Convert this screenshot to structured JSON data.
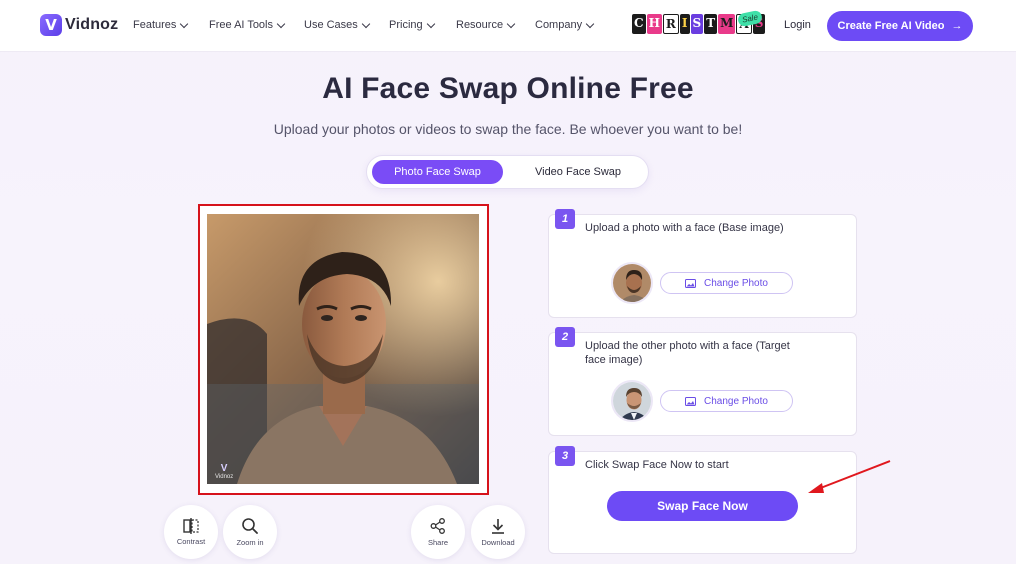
{
  "nav": {
    "brand": "Vidnoz",
    "brand_mark": "V",
    "items": [
      {
        "label": "Features"
      },
      {
        "label": "Free AI Tools"
      },
      {
        "label": "Use Cases"
      },
      {
        "label": "Pricing"
      },
      {
        "label": "Resource"
      },
      {
        "label": "Company"
      }
    ],
    "promo": {
      "letters": [
        "C",
        "H",
        "R",
        "I",
        "S",
        "T",
        "M",
        "A",
        "S"
      ],
      "badge": "Sale"
    },
    "login": "Login",
    "cta": "Create Free AI Video",
    "cta_arrow": "→"
  },
  "hero": {
    "title": "AI Face Swap Online Free",
    "subtitle": "Upload your photos or videos to swap the face. Be whoever you want to be!"
  },
  "tabs": {
    "active": "Photo Face Swap",
    "inactive": "Video Face Swap"
  },
  "preview": {
    "watermark_mark": "V",
    "watermark_text": "Vidnoz"
  },
  "tools": {
    "contrast": "Contrast",
    "zoom": "Zoom in",
    "share": "Share",
    "download": "Download"
  },
  "steps": [
    {
      "num": "1",
      "text": "Upload a photo with a face (Base image)",
      "button": "Change Photo"
    },
    {
      "num": "2",
      "text": "Upload the other photo with a face (Target face image)",
      "button": "Change Photo"
    },
    {
      "num": "3",
      "text": "Click Swap Face Now to start",
      "button": "Swap Face Now"
    }
  ],
  "colors": {
    "accent": "#6d4bf5",
    "highlight_border": "#d6121b"
  }
}
